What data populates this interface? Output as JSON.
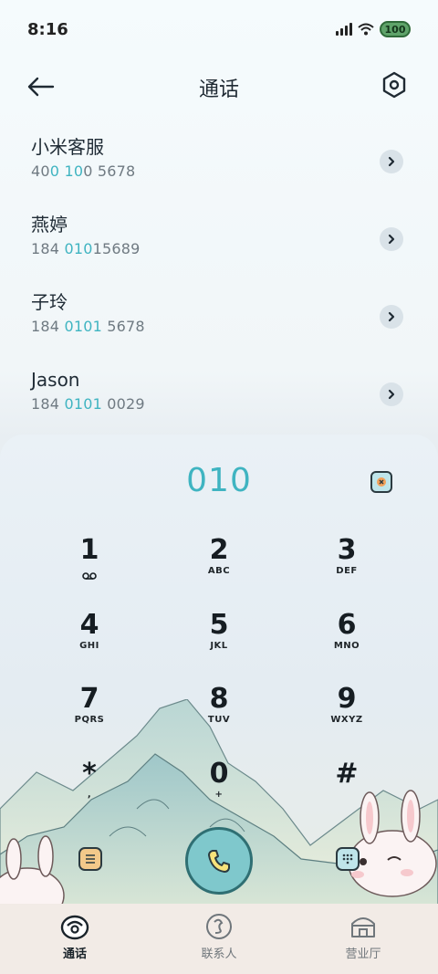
{
  "status": {
    "time": "8:16",
    "battery": "100"
  },
  "header": {
    "title": "通话"
  },
  "contacts": [
    {
      "name": "小米客服",
      "number_parts": [
        "40",
        "0",
        " ",
        "10",
        "0 5678"
      ]
    },
    {
      "name": "燕婷",
      "number_parts": [
        "184 ",
        "010",
        "",
        "",
        "15689"
      ]
    },
    {
      "name": "子玲",
      "number_parts": [
        "184 ",
        "0101",
        "",
        "",
        " 5678"
      ]
    },
    {
      "name": "Jason",
      "number_parts": [
        "184 ",
        "0101",
        "",
        "",
        " 0029"
      ]
    }
  ],
  "dialpad": {
    "input_value": "010",
    "keys": [
      {
        "digit": "1",
        "letters": ""
      },
      {
        "digit": "2",
        "letters": "ABC"
      },
      {
        "digit": "3",
        "letters": "DEF"
      },
      {
        "digit": "4",
        "letters": "GHI"
      },
      {
        "digit": "5",
        "letters": "JKL"
      },
      {
        "digit": "6",
        "letters": "MNO"
      },
      {
        "digit": "7",
        "letters": "PQRS"
      },
      {
        "digit": "8",
        "letters": "TUV"
      },
      {
        "digit": "9",
        "letters": "WXYZ"
      },
      {
        "digit": "*",
        "letters": ","
      },
      {
        "digit": "0",
        "letters": "+"
      },
      {
        "digit": "#",
        "letters": ""
      }
    ]
  },
  "nav": {
    "calls": "通话",
    "contacts": "联系人",
    "service": "营业厅"
  },
  "colors": {
    "accent": "#3fb4c1",
    "call_button": "#7fc8cc"
  }
}
